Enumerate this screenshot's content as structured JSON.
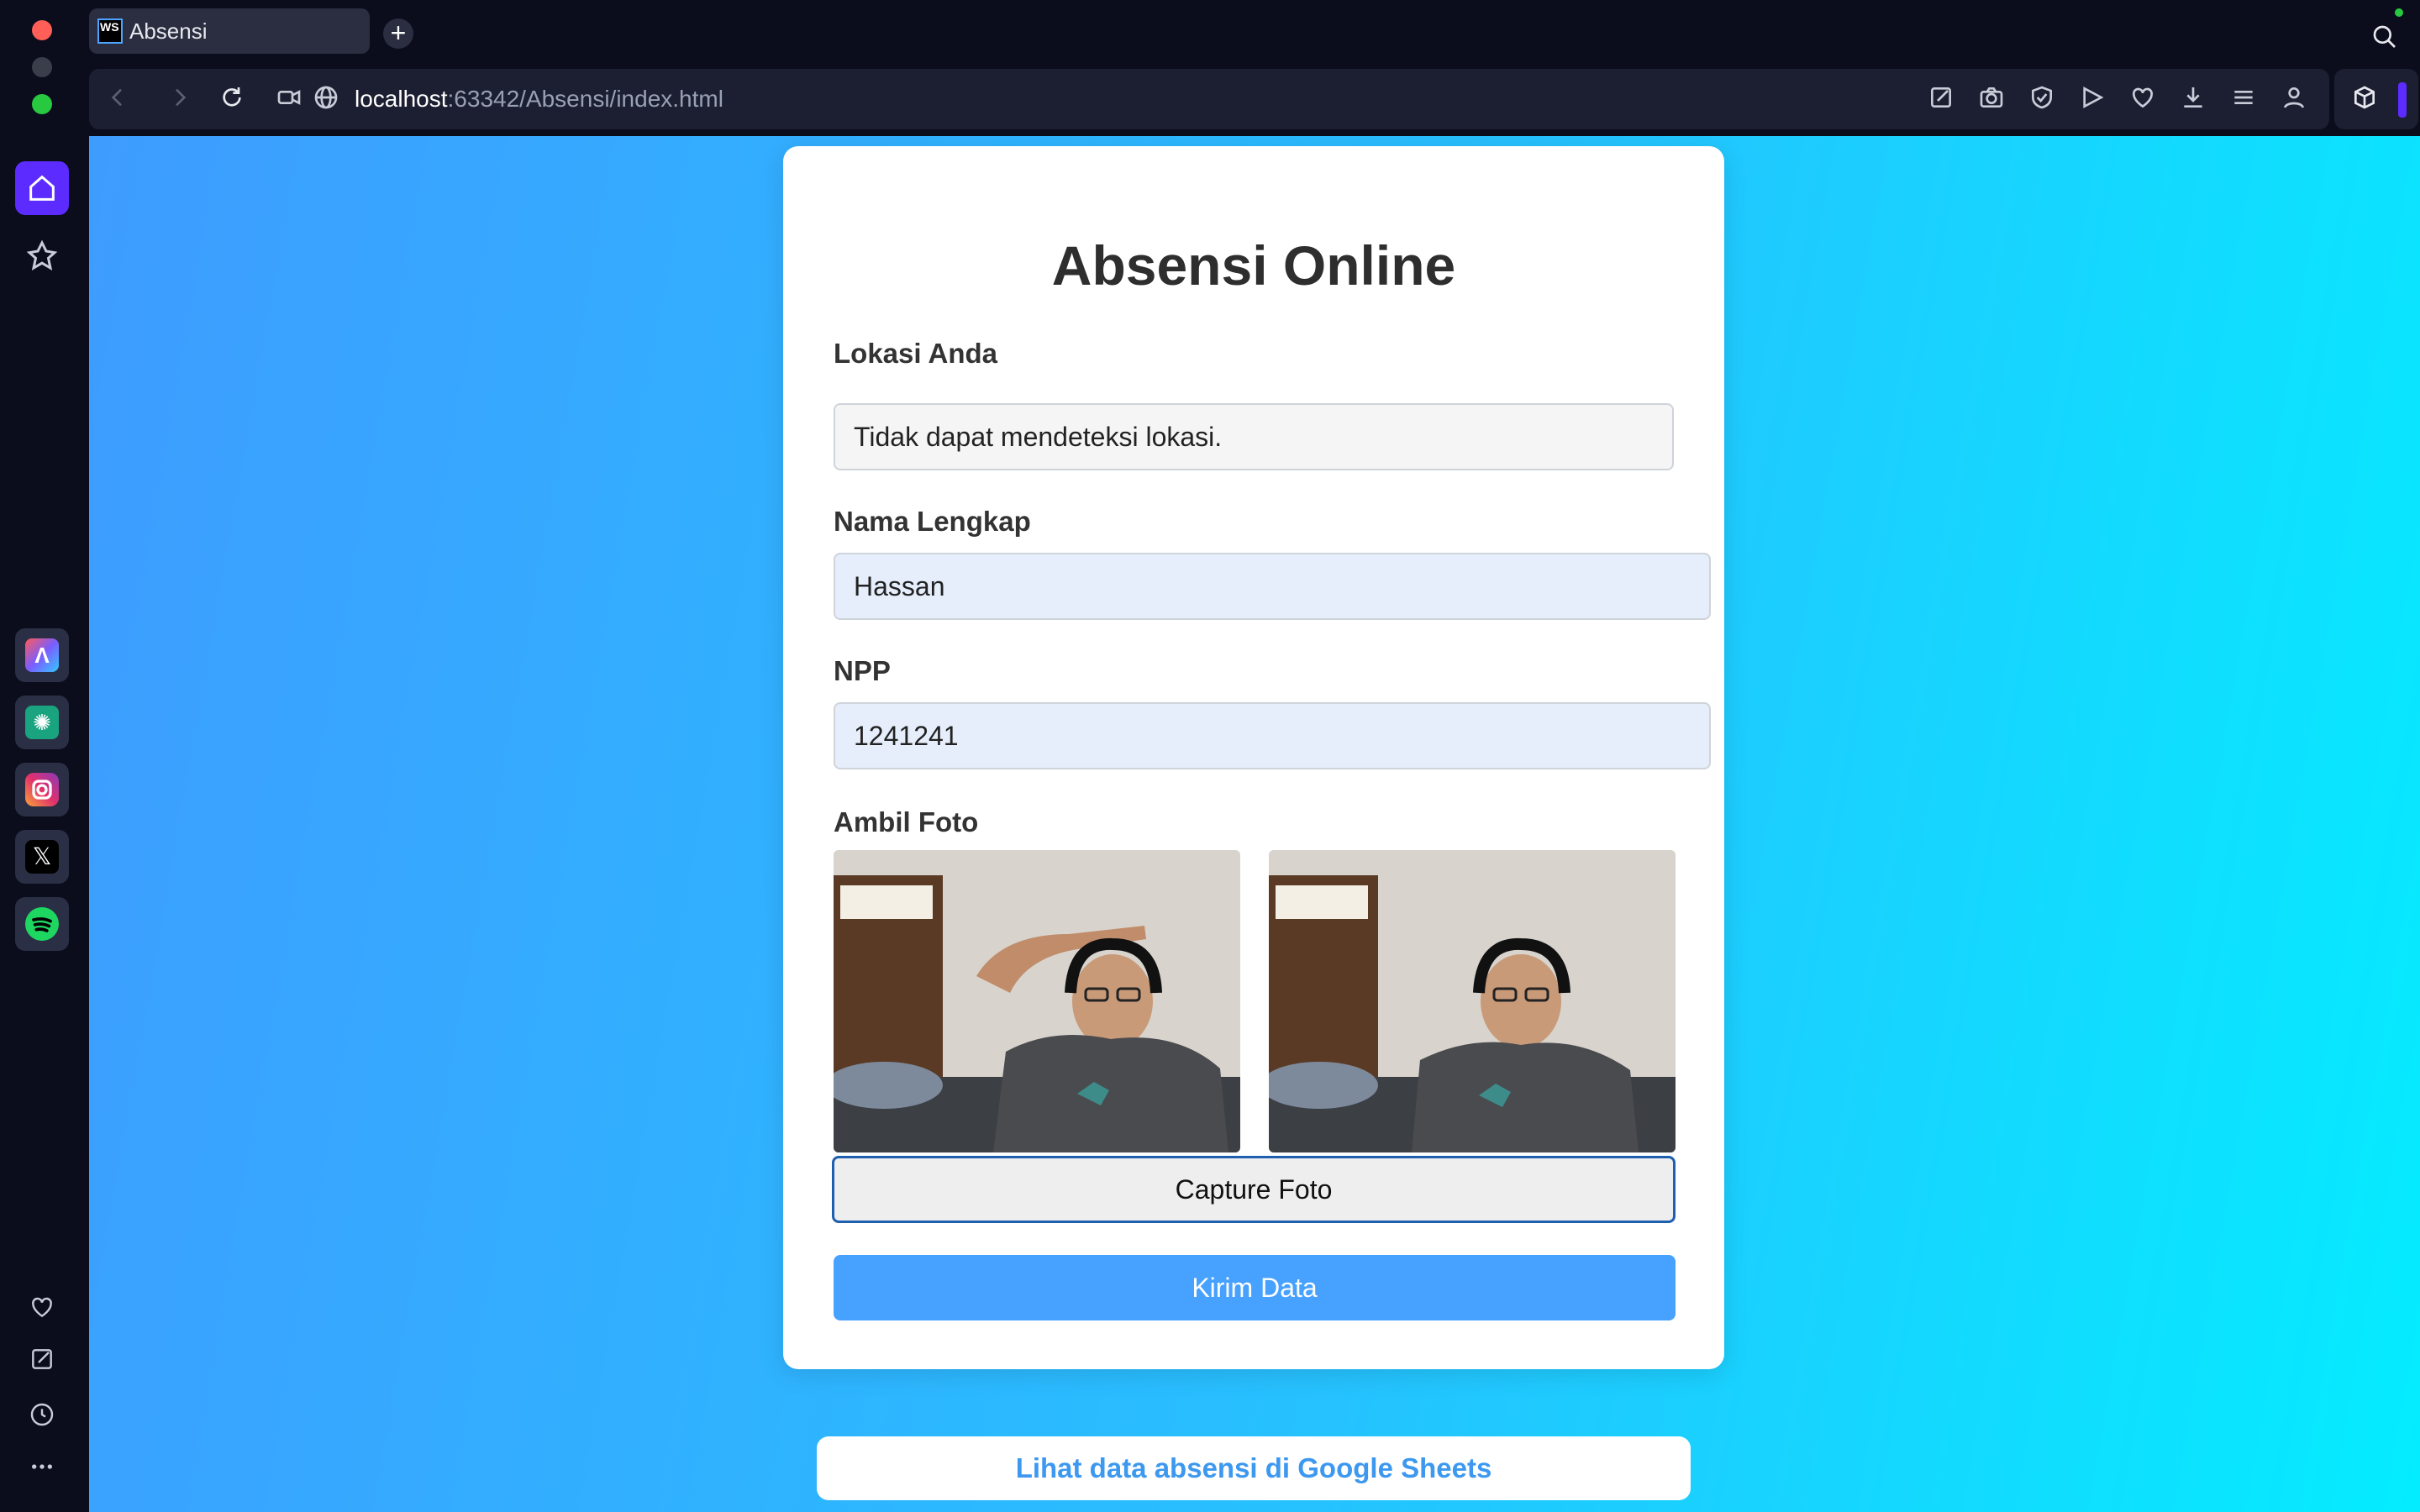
{
  "browser": {
    "tab_title": "Absensi",
    "tab_favicon": "WS",
    "url_host": "localhost",
    "url_rest": ":63342/Absensi/index.html"
  },
  "form": {
    "title": "Absensi Online",
    "location_label": "Lokasi Anda",
    "location_value": "Tidak dapat mendeteksi lokasi.",
    "name_label": "Nama Lengkap",
    "name_value": "Hassan",
    "npp_label": "NPP",
    "npp_value": "1241241",
    "photo_label": "Ambil Foto",
    "capture_button": "Capture Foto",
    "submit_button": "Kirim Data"
  },
  "footer_link": "Lihat data absensi di Google Sheets",
  "colors": {
    "accent": "#46a1ff",
    "gradient_start": "#3e9cff",
    "gradient_end": "#04ecff",
    "sidebar_active": "#5b2bff"
  }
}
